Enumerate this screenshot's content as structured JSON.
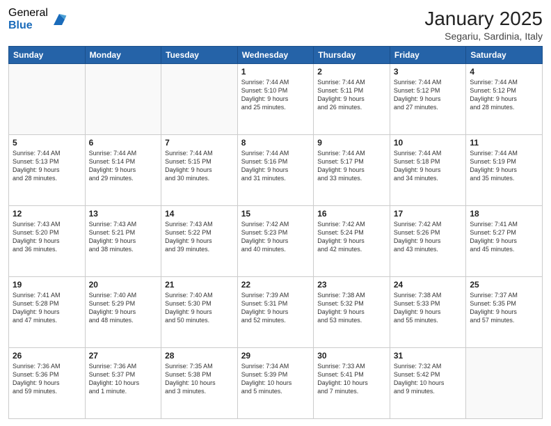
{
  "logo": {
    "general": "General",
    "blue": "Blue"
  },
  "header": {
    "month": "January 2025",
    "location": "Segariu, Sardinia, Italy"
  },
  "weekdays": [
    "Sunday",
    "Monday",
    "Tuesday",
    "Wednesday",
    "Thursday",
    "Friday",
    "Saturday"
  ],
  "weeks": [
    [
      {
        "day": "",
        "info": ""
      },
      {
        "day": "",
        "info": ""
      },
      {
        "day": "",
        "info": ""
      },
      {
        "day": "1",
        "info": "Sunrise: 7:44 AM\nSunset: 5:10 PM\nDaylight: 9 hours\nand 25 minutes."
      },
      {
        "day": "2",
        "info": "Sunrise: 7:44 AM\nSunset: 5:11 PM\nDaylight: 9 hours\nand 26 minutes."
      },
      {
        "day": "3",
        "info": "Sunrise: 7:44 AM\nSunset: 5:12 PM\nDaylight: 9 hours\nand 27 minutes."
      },
      {
        "day": "4",
        "info": "Sunrise: 7:44 AM\nSunset: 5:12 PM\nDaylight: 9 hours\nand 28 minutes."
      }
    ],
    [
      {
        "day": "5",
        "info": "Sunrise: 7:44 AM\nSunset: 5:13 PM\nDaylight: 9 hours\nand 28 minutes."
      },
      {
        "day": "6",
        "info": "Sunrise: 7:44 AM\nSunset: 5:14 PM\nDaylight: 9 hours\nand 29 minutes."
      },
      {
        "day": "7",
        "info": "Sunrise: 7:44 AM\nSunset: 5:15 PM\nDaylight: 9 hours\nand 30 minutes."
      },
      {
        "day": "8",
        "info": "Sunrise: 7:44 AM\nSunset: 5:16 PM\nDaylight: 9 hours\nand 31 minutes."
      },
      {
        "day": "9",
        "info": "Sunrise: 7:44 AM\nSunset: 5:17 PM\nDaylight: 9 hours\nand 33 minutes."
      },
      {
        "day": "10",
        "info": "Sunrise: 7:44 AM\nSunset: 5:18 PM\nDaylight: 9 hours\nand 34 minutes."
      },
      {
        "day": "11",
        "info": "Sunrise: 7:44 AM\nSunset: 5:19 PM\nDaylight: 9 hours\nand 35 minutes."
      }
    ],
    [
      {
        "day": "12",
        "info": "Sunrise: 7:43 AM\nSunset: 5:20 PM\nDaylight: 9 hours\nand 36 minutes."
      },
      {
        "day": "13",
        "info": "Sunrise: 7:43 AM\nSunset: 5:21 PM\nDaylight: 9 hours\nand 38 minutes."
      },
      {
        "day": "14",
        "info": "Sunrise: 7:43 AM\nSunset: 5:22 PM\nDaylight: 9 hours\nand 39 minutes."
      },
      {
        "day": "15",
        "info": "Sunrise: 7:42 AM\nSunset: 5:23 PM\nDaylight: 9 hours\nand 40 minutes."
      },
      {
        "day": "16",
        "info": "Sunrise: 7:42 AM\nSunset: 5:24 PM\nDaylight: 9 hours\nand 42 minutes."
      },
      {
        "day": "17",
        "info": "Sunrise: 7:42 AM\nSunset: 5:26 PM\nDaylight: 9 hours\nand 43 minutes."
      },
      {
        "day": "18",
        "info": "Sunrise: 7:41 AM\nSunset: 5:27 PM\nDaylight: 9 hours\nand 45 minutes."
      }
    ],
    [
      {
        "day": "19",
        "info": "Sunrise: 7:41 AM\nSunset: 5:28 PM\nDaylight: 9 hours\nand 47 minutes."
      },
      {
        "day": "20",
        "info": "Sunrise: 7:40 AM\nSunset: 5:29 PM\nDaylight: 9 hours\nand 48 minutes."
      },
      {
        "day": "21",
        "info": "Sunrise: 7:40 AM\nSunset: 5:30 PM\nDaylight: 9 hours\nand 50 minutes."
      },
      {
        "day": "22",
        "info": "Sunrise: 7:39 AM\nSunset: 5:31 PM\nDaylight: 9 hours\nand 52 minutes."
      },
      {
        "day": "23",
        "info": "Sunrise: 7:38 AM\nSunset: 5:32 PM\nDaylight: 9 hours\nand 53 minutes."
      },
      {
        "day": "24",
        "info": "Sunrise: 7:38 AM\nSunset: 5:33 PM\nDaylight: 9 hours\nand 55 minutes."
      },
      {
        "day": "25",
        "info": "Sunrise: 7:37 AM\nSunset: 5:35 PM\nDaylight: 9 hours\nand 57 minutes."
      }
    ],
    [
      {
        "day": "26",
        "info": "Sunrise: 7:36 AM\nSunset: 5:36 PM\nDaylight: 9 hours\nand 59 minutes."
      },
      {
        "day": "27",
        "info": "Sunrise: 7:36 AM\nSunset: 5:37 PM\nDaylight: 10 hours\nand 1 minute."
      },
      {
        "day": "28",
        "info": "Sunrise: 7:35 AM\nSunset: 5:38 PM\nDaylight: 10 hours\nand 3 minutes."
      },
      {
        "day": "29",
        "info": "Sunrise: 7:34 AM\nSunset: 5:39 PM\nDaylight: 10 hours\nand 5 minutes."
      },
      {
        "day": "30",
        "info": "Sunrise: 7:33 AM\nSunset: 5:41 PM\nDaylight: 10 hours\nand 7 minutes."
      },
      {
        "day": "31",
        "info": "Sunrise: 7:32 AM\nSunset: 5:42 PM\nDaylight: 10 hours\nand 9 minutes."
      },
      {
        "day": "",
        "info": ""
      }
    ]
  ]
}
